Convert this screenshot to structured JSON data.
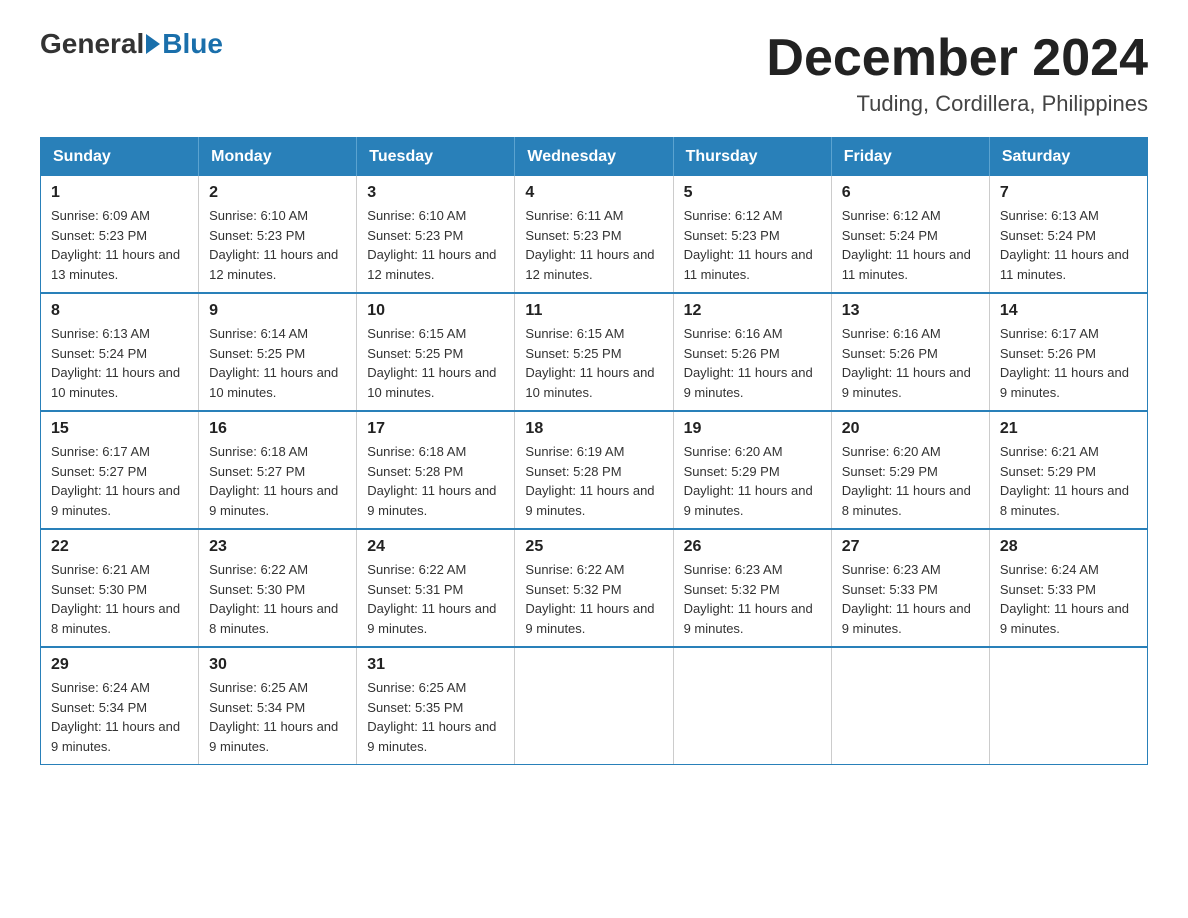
{
  "logo": {
    "text_general": "General",
    "text_blue": "Blue"
  },
  "header": {
    "month_title": "December 2024",
    "location": "Tuding, Cordillera, Philippines"
  },
  "weekdays": [
    "Sunday",
    "Monday",
    "Tuesday",
    "Wednesday",
    "Thursday",
    "Friday",
    "Saturday"
  ],
  "weeks": [
    [
      {
        "day": "1",
        "sunrise": "6:09 AM",
        "sunset": "5:23 PM",
        "daylight": "11 hours and 13 minutes."
      },
      {
        "day": "2",
        "sunrise": "6:10 AM",
        "sunset": "5:23 PM",
        "daylight": "11 hours and 12 minutes."
      },
      {
        "day": "3",
        "sunrise": "6:10 AM",
        "sunset": "5:23 PM",
        "daylight": "11 hours and 12 minutes."
      },
      {
        "day": "4",
        "sunrise": "6:11 AM",
        "sunset": "5:23 PM",
        "daylight": "11 hours and 12 minutes."
      },
      {
        "day": "5",
        "sunrise": "6:12 AM",
        "sunset": "5:23 PM",
        "daylight": "11 hours and 11 minutes."
      },
      {
        "day": "6",
        "sunrise": "6:12 AM",
        "sunset": "5:24 PM",
        "daylight": "11 hours and 11 minutes."
      },
      {
        "day": "7",
        "sunrise": "6:13 AM",
        "sunset": "5:24 PM",
        "daylight": "11 hours and 11 minutes."
      }
    ],
    [
      {
        "day": "8",
        "sunrise": "6:13 AM",
        "sunset": "5:24 PM",
        "daylight": "11 hours and 10 minutes."
      },
      {
        "day": "9",
        "sunrise": "6:14 AM",
        "sunset": "5:25 PM",
        "daylight": "11 hours and 10 minutes."
      },
      {
        "day": "10",
        "sunrise": "6:15 AM",
        "sunset": "5:25 PM",
        "daylight": "11 hours and 10 minutes."
      },
      {
        "day": "11",
        "sunrise": "6:15 AM",
        "sunset": "5:25 PM",
        "daylight": "11 hours and 10 minutes."
      },
      {
        "day": "12",
        "sunrise": "6:16 AM",
        "sunset": "5:26 PM",
        "daylight": "11 hours and 9 minutes."
      },
      {
        "day": "13",
        "sunrise": "6:16 AM",
        "sunset": "5:26 PM",
        "daylight": "11 hours and 9 minutes."
      },
      {
        "day": "14",
        "sunrise": "6:17 AM",
        "sunset": "5:26 PM",
        "daylight": "11 hours and 9 minutes."
      }
    ],
    [
      {
        "day": "15",
        "sunrise": "6:17 AM",
        "sunset": "5:27 PM",
        "daylight": "11 hours and 9 minutes."
      },
      {
        "day": "16",
        "sunrise": "6:18 AM",
        "sunset": "5:27 PM",
        "daylight": "11 hours and 9 minutes."
      },
      {
        "day": "17",
        "sunrise": "6:18 AM",
        "sunset": "5:28 PM",
        "daylight": "11 hours and 9 minutes."
      },
      {
        "day": "18",
        "sunrise": "6:19 AM",
        "sunset": "5:28 PM",
        "daylight": "11 hours and 9 minutes."
      },
      {
        "day": "19",
        "sunrise": "6:20 AM",
        "sunset": "5:29 PM",
        "daylight": "11 hours and 9 minutes."
      },
      {
        "day": "20",
        "sunrise": "6:20 AM",
        "sunset": "5:29 PM",
        "daylight": "11 hours and 8 minutes."
      },
      {
        "day": "21",
        "sunrise": "6:21 AM",
        "sunset": "5:29 PM",
        "daylight": "11 hours and 8 minutes."
      }
    ],
    [
      {
        "day": "22",
        "sunrise": "6:21 AM",
        "sunset": "5:30 PM",
        "daylight": "11 hours and 8 minutes."
      },
      {
        "day": "23",
        "sunrise": "6:22 AM",
        "sunset": "5:30 PM",
        "daylight": "11 hours and 8 minutes."
      },
      {
        "day": "24",
        "sunrise": "6:22 AM",
        "sunset": "5:31 PM",
        "daylight": "11 hours and 9 minutes."
      },
      {
        "day": "25",
        "sunrise": "6:22 AM",
        "sunset": "5:32 PM",
        "daylight": "11 hours and 9 minutes."
      },
      {
        "day": "26",
        "sunrise": "6:23 AM",
        "sunset": "5:32 PM",
        "daylight": "11 hours and 9 minutes."
      },
      {
        "day": "27",
        "sunrise": "6:23 AM",
        "sunset": "5:33 PM",
        "daylight": "11 hours and 9 minutes."
      },
      {
        "day": "28",
        "sunrise": "6:24 AM",
        "sunset": "5:33 PM",
        "daylight": "11 hours and 9 minutes."
      }
    ],
    [
      {
        "day": "29",
        "sunrise": "6:24 AM",
        "sunset": "5:34 PM",
        "daylight": "11 hours and 9 minutes."
      },
      {
        "day": "30",
        "sunrise": "6:25 AM",
        "sunset": "5:34 PM",
        "daylight": "11 hours and 9 minutes."
      },
      {
        "day": "31",
        "sunrise": "6:25 AM",
        "sunset": "5:35 PM",
        "daylight": "11 hours and 9 minutes."
      },
      null,
      null,
      null,
      null
    ]
  ]
}
